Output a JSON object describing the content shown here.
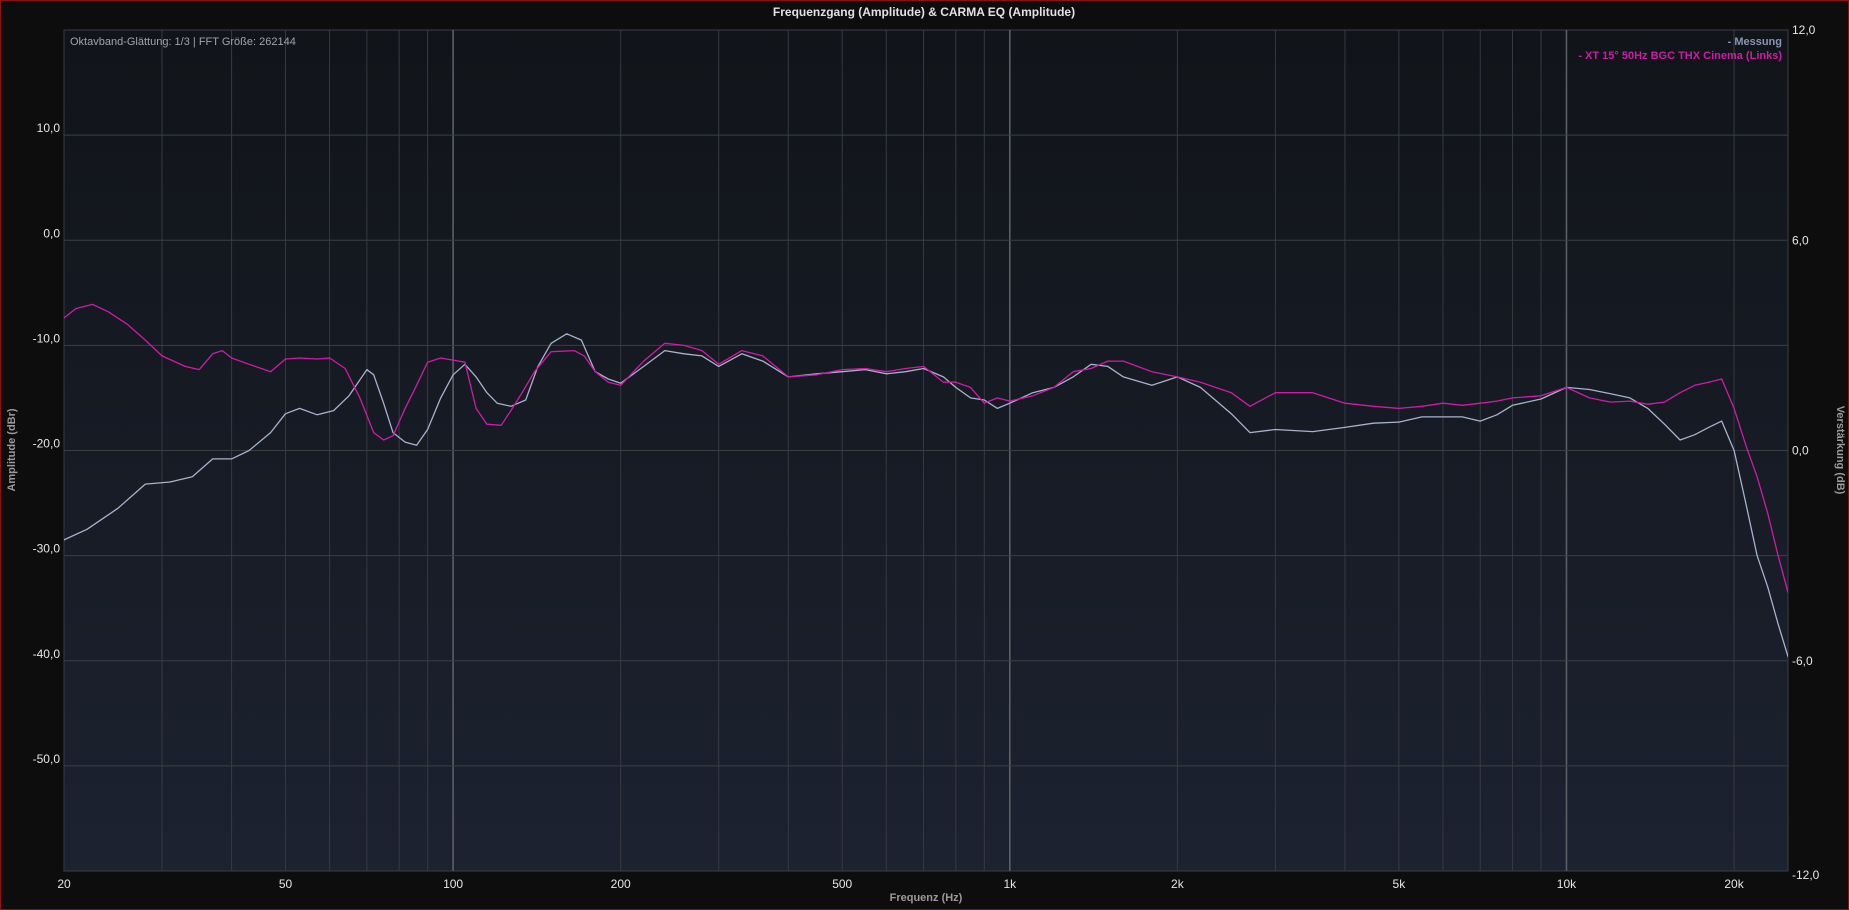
{
  "window": {
    "title": "Frequenzgang (Amplitude) & CARMA EQ (Amplitude)",
    "info": "Oktavband-Glättung: 1/3 | FFT Größe: 262144"
  },
  "colors": {
    "series_measurement": "#a7b2cc",
    "series_target": "#d11aa8",
    "plot_bg_top": "#111419",
    "plot_bg_bottom": "#1c2230"
  },
  "chart_data": {
    "type": "line",
    "title": "Frequenzgang (Amplitude) & CARMA EQ (Amplitude)",
    "xlabel": "Frequenz (Hz)",
    "ylabel": "Amplitude (dBr)",
    "y2label": "Verstärkung (dB)",
    "x_scale": "log",
    "xlim": [
      20,
      25000
    ],
    "ylim": [
      -60,
      20
    ],
    "y2lim": [
      -12,
      12
    ],
    "grid": true,
    "legend_position": "top-right",
    "x_ticks": [
      {
        "value": 20,
        "label": "20"
      },
      {
        "value": 50,
        "label": "50"
      },
      {
        "value": 100,
        "label": "100"
      },
      {
        "value": 200,
        "label": "200"
      },
      {
        "value": 500,
        "label": "500"
      },
      {
        "value": 1000,
        "label": "1k"
      },
      {
        "value": 2000,
        "label": "2k"
      },
      {
        "value": 5000,
        "label": "5k"
      },
      {
        "value": 10000,
        "label": "10k"
      },
      {
        "value": 20000,
        "label": "20k"
      }
    ],
    "y_ticks": [
      {
        "value": 10,
        "label": "10,0"
      },
      {
        "value": 0,
        "label": "0,0"
      },
      {
        "value": -10,
        "label": "-10,0"
      },
      {
        "value": -20,
        "label": "-20,0"
      },
      {
        "value": -30,
        "label": "-30,0"
      },
      {
        "value": -40,
        "label": "-40,0"
      },
      {
        "value": -50,
        "label": "-50,0"
      }
    ],
    "y2_ticks": [
      {
        "value": 12,
        "label": "12,0"
      },
      {
        "value": 6,
        "label": "6,0"
      },
      {
        "value": 0,
        "label": "0,0"
      },
      {
        "value": -6,
        "label": "-6,0"
      },
      {
        "value": -12,
        "label": "-12,0"
      }
    ],
    "series": [
      {
        "name": "- Messung",
        "color": "#a7b2cc",
        "points": [
          [
            20,
            -28.5
          ],
          [
            22,
            -27.5
          ],
          [
            25,
            -25.5
          ],
          [
            28,
            -23.2
          ],
          [
            31,
            -23.0
          ],
          [
            34,
            -22.5
          ],
          [
            37,
            -20.8
          ],
          [
            40,
            -20.8
          ],
          [
            43,
            -20.0
          ],
          [
            47,
            -18.3
          ],
          [
            50,
            -16.5
          ],
          [
            53,
            -16.0
          ],
          [
            57,
            -16.6
          ],
          [
            61,
            -16.2
          ],
          [
            65,
            -14.8
          ],
          [
            70,
            -12.3
          ],
          [
            72,
            -12.8
          ],
          [
            75,
            -15.5
          ],
          [
            78,
            -18.3
          ],
          [
            82,
            -19.2
          ],
          [
            86,
            -19.5
          ],
          [
            90,
            -18.0
          ],
          [
            95,
            -15.0
          ],
          [
            100,
            -12.8
          ],
          [
            105,
            -11.8
          ],
          [
            110,
            -13.0
          ],
          [
            115,
            -14.5
          ],
          [
            120,
            -15.5
          ],
          [
            127,
            -15.8
          ],
          [
            135,
            -15.2
          ],
          [
            142,
            -12.0
          ],
          [
            150,
            -9.8
          ],
          [
            160,
            -8.9
          ],
          [
            170,
            -9.5
          ],
          [
            180,
            -12.5
          ],
          [
            190,
            -13.2
          ],
          [
            200,
            -13.6
          ],
          [
            220,
            -12.0
          ],
          [
            240,
            -10.5
          ],
          [
            260,
            -10.8
          ],
          [
            280,
            -11.0
          ],
          [
            300,
            -12.0
          ],
          [
            330,
            -10.8
          ],
          [
            360,
            -11.5
          ],
          [
            400,
            -13.0
          ],
          [
            450,
            -12.7
          ],
          [
            500,
            -12.5
          ],
          [
            550,
            -12.3
          ],
          [
            600,
            -12.7
          ],
          [
            650,
            -12.5
          ],
          [
            700,
            -12.2
          ],
          [
            760,
            -13.0
          ],
          [
            800,
            -14.0
          ],
          [
            850,
            -15.0
          ],
          [
            900,
            -15.2
          ],
          [
            950,
            -16.0
          ],
          [
            1000,
            -15.5
          ],
          [
            1100,
            -14.5
          ],
          [
            1200,
            -14.0
          ],
          [
            1300,
            -13.0
          ],
          [
            1400,
            -11.8
          ],
          [
            1500,
            -12.0
          ],
          [
            1600,
            -13.0
          ],
          [
            1800,
            -13.8
          ],
          [
            2000,
            -13.0
          ],
          [
            2200,
            -14.0
          ],
          [
            2500,
            -16.5
          ],
          [
            2700,
            -18.3
          ],
          [
            3000,
            -18.0
          ],
          [
            3500,
            -18.2
          ],
          [
            4000,
            -17.8
          ],
          [
            4500,
            -17.4
          ],
          [
            5000,
            -17.3
          ],
          [
            5500,
            -16.8
          ],
          [
            6000,
            -16.8
          ],
          [
            6500,
            -16.8
          ],
          [
            7000,
            -17.2
          ],
          [
            7500,
            -16.6
          ],
          [
            8000,
            -15.7
          ],
          [
            9000,
            -15.1
          ],
          [
            10000,
            -14.0
          ],
          [
            11000,
            -14.2
          ],
          [
            12000,
            -14.6
          ],
          [
            13000,
            -15.0
          ],
          [
            14000,
            -16.0
          ],
          [
            15000,
            -17.5
          ],
          [
            16000,
            -19.0
          ],
          [
            17000,
            -18.5
          ],
          [
            18000,
            -17.8
          ],
          [
            19000,
            -17.2
          ],
          [
            20000,
            -20.0
          ],
          [
            21000,
            -25.0
          ],
          [
            22000,
            -30.0
          ],
          [
            23000,
            -33.0
          ],
          [
            24000,
            -36.5
          ],
          [
            25000,
            -39.6
          ]
        ]
      },
      {
        "name": "- XT 15° 50Hz BGC THX Cinema (Links)",
        "color": "#d11aa8",
        "points": [
          [
            20,
            -7.4
          ],
          [
            21,
            -6.5
          ],
          [
            22.5,
            -6.1
          ],
          [
            24,
            -6.8
          ],
          [
            26,
            -8.0
          ],
          [
            28,
            -9.5
          ],
          [
            30,
            -11.0
          ],
          [
            33,
            -12.0
          ],
          [
            35,
            -12.3
          ],
          [
            37,
            -10.8
          ],
          [
            38.5,
            -10.5
          ],
          [
            40,
            -11.2
          ],
          [
            43,
            -11.8
          ],
          [
            47,
            -12.5
          ],
          [
            50,
            -11.3
          ],
          [
            53,
            -11.2
          ],
          [
            57,
            -11.3
          ],
          [
            60,
            -11.2
          ],
          [
            64,
            -12.2
          ],
          [
            68,
            -15.0
          ],
          [
            72,
            -18.3
          ],
          [
            75,
            -19.0
          ],
          [
            78,
            -18.6
          ],
          [
            82,
            -16.0
          ],
          [
            86,
            -13.8
          ],
          [
            90,
            -11.6
          ],
          [
            95,
            -11.2
          ],
          [
            100,
            -11.4
          ],
          [
            105,
            -11.6
          ],
          [
            110,
            -16.0
          ],
          [
            115,
            -17.5
          ],
          [
            122,
            -17.6
          ],
          [
            127,
            -16.2
          ],
          [
            133,
            -14.5
          ],
          [
            140,
            -12.5
          ],
          [
            150,
            -10.6
          ],
          [
            165,
            -10.5
          ],
          [
            172,
            -11.0
          ],
          [
            180,
            -12.5
          ],
          [
            190,
            -13.5
          ],
          [
            200,
            -13.8
          ],
          [
            220,
            -11.5
          ],
          [
            240,
            -9.8
          ],
          [
            260,
            -10.0
          ],
          [
            280,
            -10.5
          ],
          [
            300,
            -11.8
          ],
          [
            330,
            -10.5
          ],
          [
            360,
            -11.0
          ],
          [
            400,
            -13.0
          ],
          [
            450,
            -12.8
          ],
          [
            500,
            -12.3
          ],
          [
            550,
            -12.2
          ],
          [
            600,
            -12.5
          ],
          [
            650,
            -12.2
          ],
          [
            700,
            -12.0
          ],
          [
            760,
            -13.5
          ],
          [
            800,
            -13.5
          ],
          [
            850,
            -14.0
          ],
          [
            900,
            -15.5
          ],
          [
            950,
            -15.0
          ],
          [
            1000,
            -15.3
          ],
          [
            1100,
            -14.8
          ],
          [
            1200,
            -14.0
          ],
          [
            1300,
            -12.5
          ],
          [
            1400,
            -12.2
          ],
          [
            1500,
            -11.5
          ],
          [
            1600,
            -11.5
          ],
          [
            1800,
            -12.5
          ],
          [
            2000,
            -13.0
          ],
          [
            2200,
            -13.5
          ],
          [
            2500,
            -14.5
          ],
          [
            2700,
            -15.8
          ],
          [
            3000,
            -14.5
          ],
          [
            3500,
            -14.5
          ],
          [
            4000,
            -15.5
          ],
          [
            4500,
            -15.8
          ],
          [
            5000,
            -16.0
          ],
          [
            5500,
            -15.8
          ],
          [
            6000,
            -15.5
          ],
          [
            6500,
            -15.7
          ],
          [
            7000,
            -15.5
          ],
          [
            7500,
            -15.3
          ],
          [
            8000,
            -15.0
          ],
          [
            9000,
            -14.8
          ],
          [
            10000,
            -14.0
          ],
          [
            11000,
            -15.0
          ],
          [
            12000,
            -15.4
          ],
          [
            13000,
            -15.3
          ],
          [
            14000,
            -15.6
          ],
          [
            15000,
            -15.4
          ],
          [
            16000,
            -14.5
          ],
          [
            17000,
            -13.8
          ],
          [
            18000,
            -13.5
          ],
          [
            19000,
            -13.2
          ],
          [
            20000,
            -16.0
          ],
          [
            21000,
            -19.5
          ],
          [
            22000,
            -22.5
          ],
          [
            23000,
            -26.0
          ],
          [
            24000,
            -30.0
          ],
          [
            25000,
            -33.5
          ]
        ]
      }
    ]
  }
}
